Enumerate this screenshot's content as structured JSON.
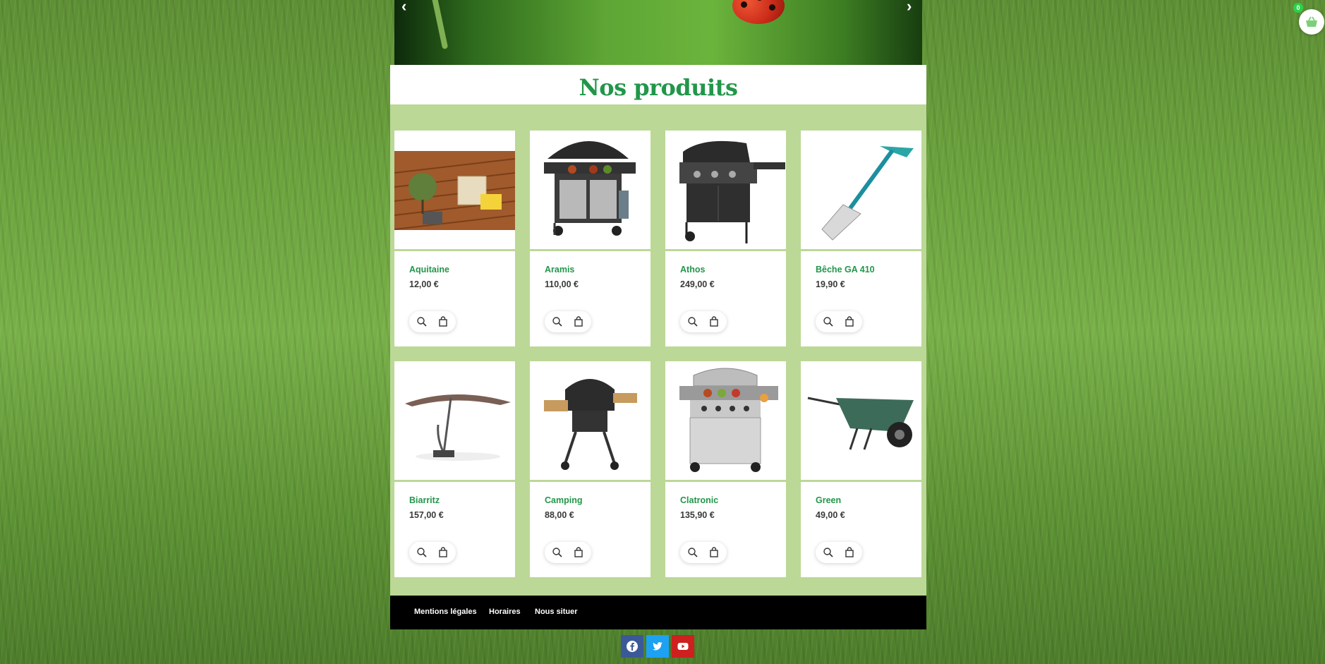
{
  "hero": {
    "prev_icon": "chevron-left-icon",
    "next_icon": "chevron-right-icon"
  },
  "section_title": "Nos produits",
  "products": [
    {
      "name": "Aquitaine",
      "price": "12,00 €"
    },
    {
      "name": "Aramis",
      "price": "110,00 €"
    },
    {
      "name": "Athos",
      "price": "249,00 €"
    },
    {
      "name": "Bêche GA 410",
      "price": "19,90 €"
    },
    {
      "name": "Biarritz",
      "price": "157,00 €"
    },
    {
      "name": "Camping",
      "price": "88,00 €"
    },
    {
      "name": "Clatronic",
      "price": "135,90 €"
    },
    {
      "name": "Green",
      "price": "49,00 €"
    }
  ],
  "footer": {
    "links": [
      "Mentions légales",
      "Horaires",
      "Nous situer"
    ]
  },
  "social": [
    "facebook-icon",
    "twitter-icon",
    "youtube-icon"
  ],
  "cart": {
    "count": "0"
  },
  "colors": {
    "accent": "#22964a",
    "section_bg": "#bbd896",
    "footer_bg": "#000000",
    "cart_badge": "#2bd24b"
  }
}
